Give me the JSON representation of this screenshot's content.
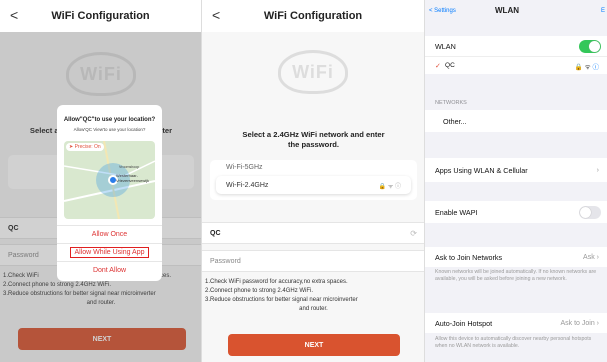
{
  "s1": {
    "title": "WiFi Configuration",
    "back": "<",
    "logo": "WiFi",
    "instruction": "Select a 2.4GHz WiFi network and enter",
    "alert_title": "Allow\"QC\"to use your location?",
    "alert_sub": "Allow'QC View'to use your location?",
    "precise": "Precise: On",
    "map_label": "Westerhaar-Vriezenveensewijk",
    "map_small": "Vroomshoop",
    "allow_once": "Allow Once",
    "allow_while": "Allow While Using App",
    "dont_allow": "Dont Allow",
    "ssid": "QC",
    "password_placeholder": "Password",
    "tip1": "1.Check WiFi",
    "tip1_tail": "aces.",
    "tip2": "2.Connect phone to strong 2.4GHz WiFi.",
    "tip3": "3.Reduce obstructions for better signal near microinverter",
    "tip3b": "and router.",
    "next": "NEXT"
  },
  "s2": {
    "title": "WiFi Configuration",
    "back": "<",
    "logo": "WiFi",
    "instruction1": "Select a 2.4GHz WiFi network and enter",
    "instruction2": "the password.",
    "wifi5": "Wi-Fi-5GHz",
    "wifi24": "Wi-Fi-2.4GHz",
    "ssid": "QC",
    "password_placeholder": "Password",
    "tip1": "1.Check WiFi password for accuracy,no extra spaces.",
    "tip2": "2.Connect phone to strong 2.4GHz WiFi.",
    "tip3": "3.Reduce obstructions for better signal near microinverter",
    "tip3b": "and router.",
    "next": "NEXT"
  },
  "s3": {
    "back": "< Settings",
    "title": "WLAN",
    "edit": "E",
    "wlan": "WLAN",
    "connected": "QC",
    "networks_header": "NETWORKS",
    "other": "Other...",
    "apps": "Apps Using WLAN & Cellular",
    "wapi": "Enable WAPI",
    "ask": "Ask to Join Networks",
    "ask_value": "Ask",
    "ask_note": "Known networks will be joined automatically. If no known networks are available, you will be asked before joining a new network.",
    "hotspot": "Auto-Join Hotspot",
    "hotspot_value": "Ask to Join",
    "hotspot_note": "Allow this device to automatically discover nearby personal hotspots when no WLAN network is available.",
    "colors": {
      "accent": "#d9532f",
      "ios_green": "#34c759",
      "ios_blue": "#007aff",
      "check": "#e0503a"
    }
  }
}
